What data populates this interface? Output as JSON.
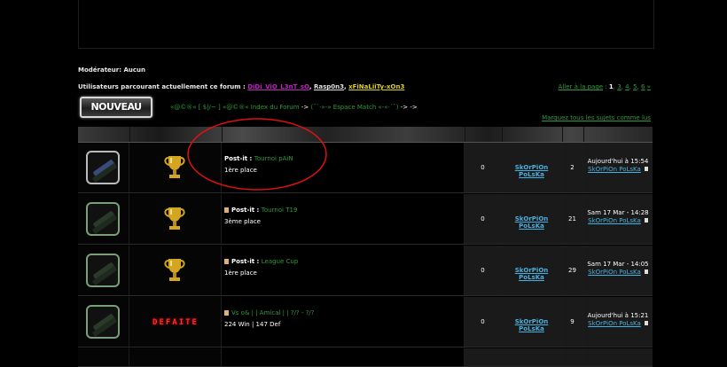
{
  "moderator": "Modérateur: Aucun",
  "users_prefix": "Utilisateurs parcourant actuellement ce forum : ",
  "users": [
    "DiDi_ViO_L3nT_sO",
    "Rasp0n3",
    "xFiNaLiiTy-xOn3"
  ],
  "pagination": {
    "label": "Aller à la page",
    "current": "1",
    "pages": [
      "3",
      "4",
      "5",
      "6"
    ],
    "next": "»"
  },
  "new_button": "NOUVEAU",
  "breadcrumb": {
    "forum": "«@©®« [ $|/~ ] «@©®« Index du Forum",
    "arrow1": "->",
    "section": "(¯`·»-» Espace Match «-«·´¯)",
    "arrow2": "->",
    "arrow3": "->"
  },
  "mark_read": "Marquez tous les sujets comme lus",
  "topics": [
    {
      "prefix": "Post-it : ",
      "title": "Tournoi pAiN",
      "subtitle": "1ère place",
      "replies": "0",
      "author": "SkOrPiOn PoLsKa",
      "views": "2",
      "last_date": "Aujourd'hui à 15:54",
      "last_author": "SkOrPiOn PoLsKa",
      "status": "trophy"
    },
    {
      "prefix": "Post-it : ",
      "title": "Tournoi T19",
      "subtitle": "3ème place",
      "replies": "0",
      "author": "SkOrPiOn PoLsKa",
      "views": "21",
      "last_date": "Sam 17 Mar - 14:28",
      "last_author": "SkOrPiOn PoLsKa",
      "status": "trophy"
    },
    {
      "prefix": "Post-it : ",
      "title": "League Cup",
      "subtitle": "1ère place",
      "replies": "0",
      "author": "SkOrPiOn PoLsKa",
      "views": "29",
      "last_date": "Sam 17 Mar - 14:05",
      "last_author": "SkOrPiOn PoLsKa",
      "status": "trophy"
    },
    {
      "prefix": "",
      "title": "Vs o& | | Amical | | ?/? - ?/?",
      "subtitle": "224 Win | 147 Def",
      "replies": "0",
      "author": "SkOrPiOn PoLsKa",
      "views": "9",
      "last_date": "Aujourd'hui à 15:21",
      "last_author": "SkOrPiOn PoLsKa",
      "status": "DEFAITE"
    }
  ],
  "colors": {
    "link_green": "#2f9a3a",
    "author_blue": "#4ab0e0",
    "user_magenta": "#c020c0",
    "user_yellow": "#e0d020",
    "annotation_red": "#e01010"
  }
}
